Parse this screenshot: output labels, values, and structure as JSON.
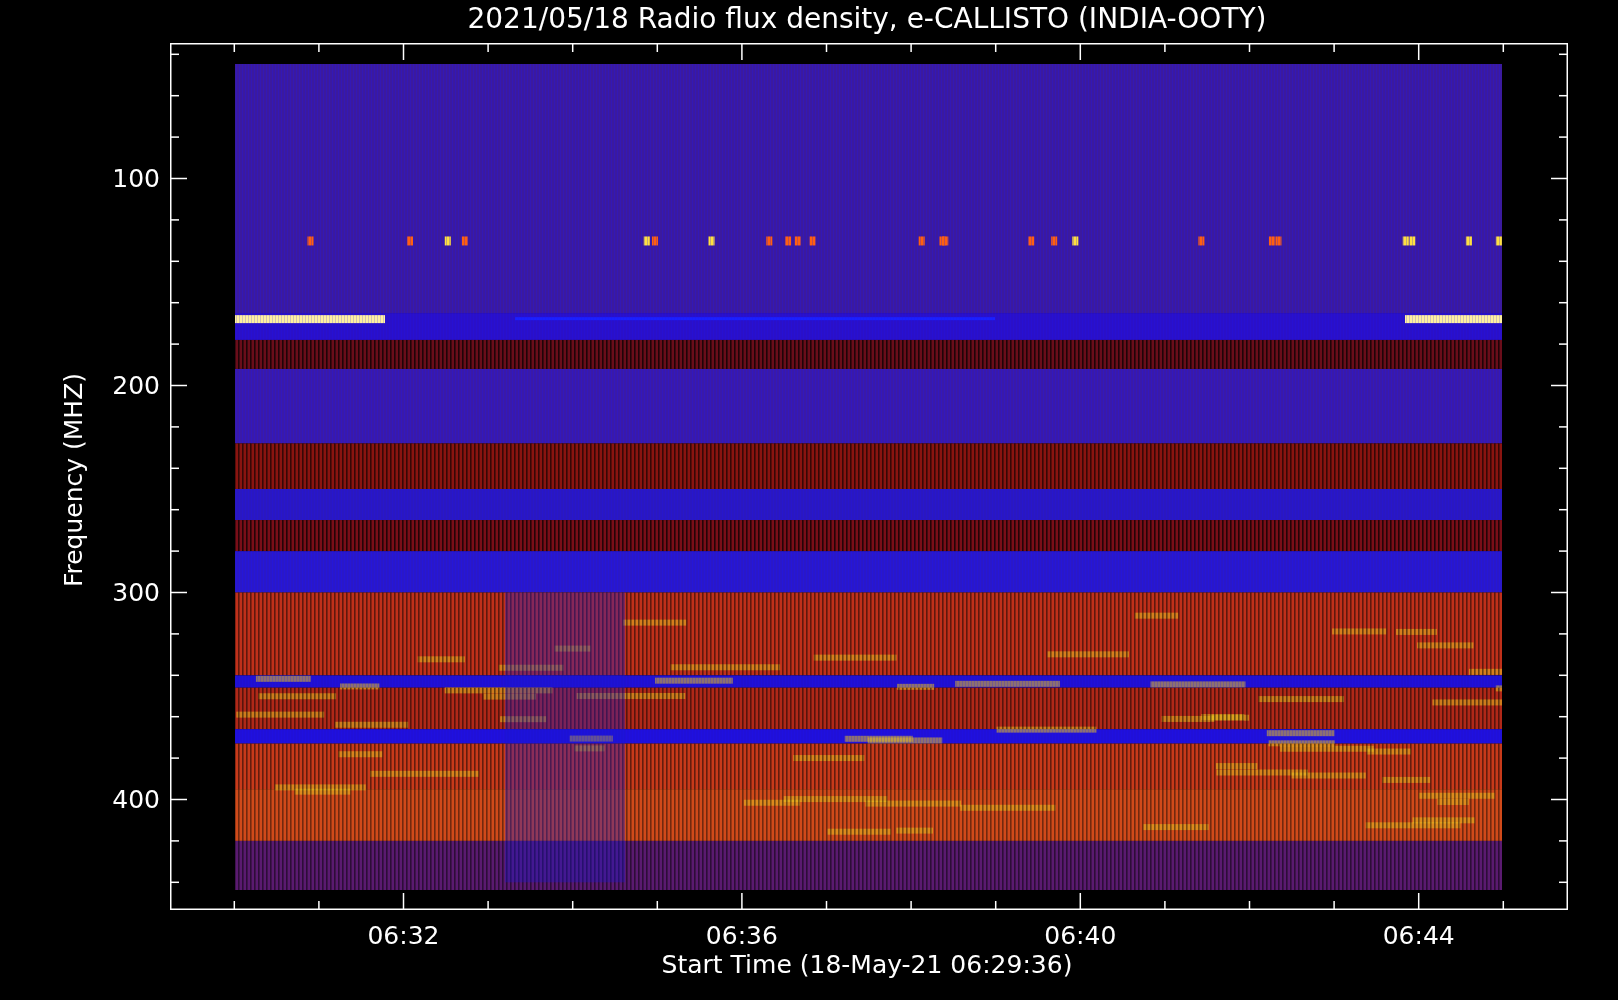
{
  "title": "2021/05/18  Radio flux density, e-CALLISTO (INDIA-OOTY)",
  "y_axis": {
    "label": "Frequency (MHZ)",
    "ticks": [
      "100",
      "200",
      "300",
      "400"
    ]
  },
  "x_axis": {
    "label": "Start Time (18-May-21 06:29:36)",
    "ticks": [
      "06:32",
      "06:36",
      "06:40",
      "06:44"
    ]
  }
}
